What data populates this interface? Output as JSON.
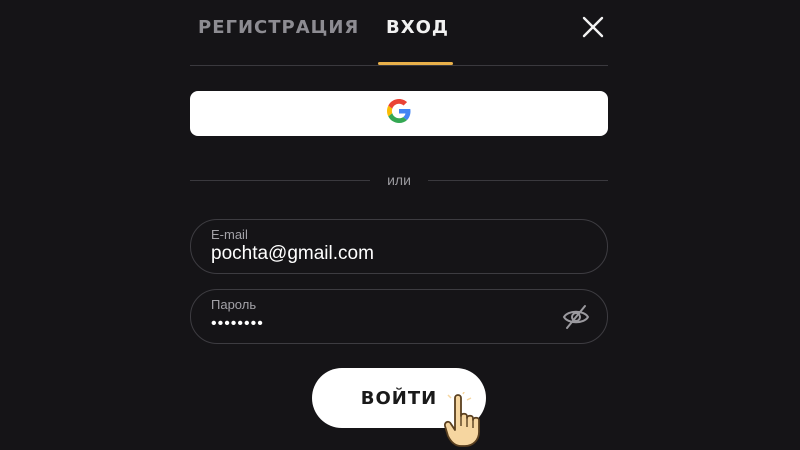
{
  "tabs": {
    "register_label": "РЕГИСТРАЦИЯ",
    "login_label": "ВХОД",
    "active": "login"
  },
  "close": {
    "icon": "close-icon"
  },
  "google": {
    "icon": "google-icon"
  },
  "divider": {
    "or_label": "или"
  },
  "email": {
    "label": "E-mail",
    "value": "pochta@gmail.com"
  },
  "password": {
    "label": "Пароль",
    "value": "••••••••",
    "toggle_icon": "eye-off-icon"
  },
  "submit": {
    "label": "ВОЙТИ"
  },
  "colors": {
    "background": "#151417",
    "accent": "#e8b04a",
    "tab_inactive": "#8d8c92",
    "field_border": "#3d3c41"
  }
}
